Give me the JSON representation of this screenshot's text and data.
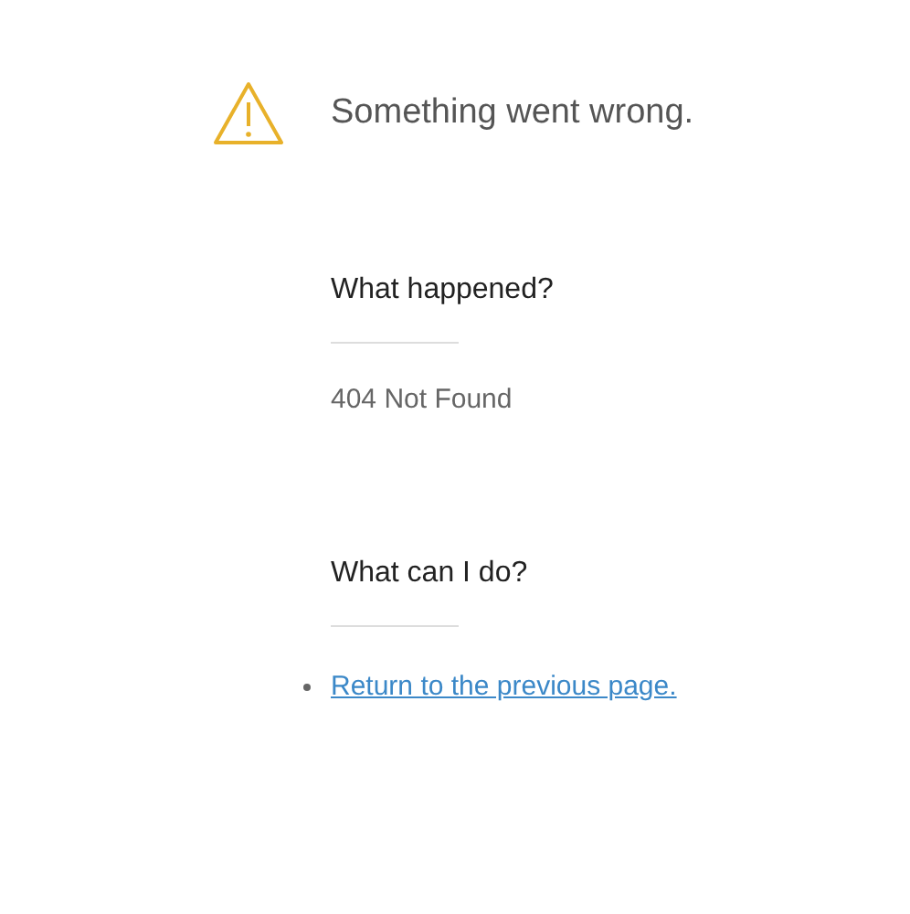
{
  "title": "Something went wrong.",
  "sections": [
    {
      "heading": "What happened?",
      "kind": "text",
      "text": "404 Not Found"
    },
    {
      "heading": "What can I do?",
      "kind": "links",
      "links": [
        "Return to the previous page."
      ]
    }
  ]
}
